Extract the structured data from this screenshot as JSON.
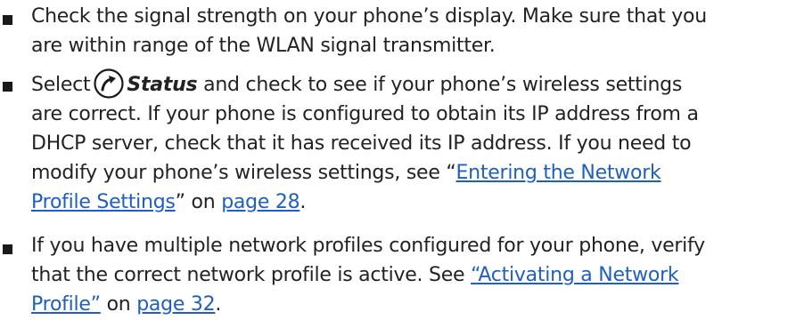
{
  "items": [
    {
      "line1": "Check the signal strength on your phone’s display. Make sure that you",
      "line2": "are within range of the WLAN signal transmitter."
    },
    {
      "select_label": "Select",
      "icon": "home-arrow-icon",
      "status_label": "Status",
      "line1_rest": "and check to see if your phone’s wireless settings",
      "line2": "are correct. If your phone is configured to obtain its IP address from a",
      "line3": "DHCP server, check that it has received its IP address. If you need to",
      "line4_pre": "modify your phone’s wireless settings, see “",
      "link1_part1": "Entering the Network",
      "link1_part2": "Profile Settings",
      "line5_mid": "” on",
      "page_link1": "page 28",
      "line5_end": "."
    },
    {
      "line1": "If you have multiple network profiles configured for your phone, verify",
      "line2_pre": "that the correct network profile is active. See",
      "link2_part1": "“Activating a Network",
      "link2_part2": "Profile”",
      "line3_mid": "on",
      "page_link2": "page 32",
      "line3_end": "."
    }
  ],
  "colors": {
    "text": "#222222",
    "link": "#1f5fbf",
    "bullet": "#1a1a1a"
  }
}
